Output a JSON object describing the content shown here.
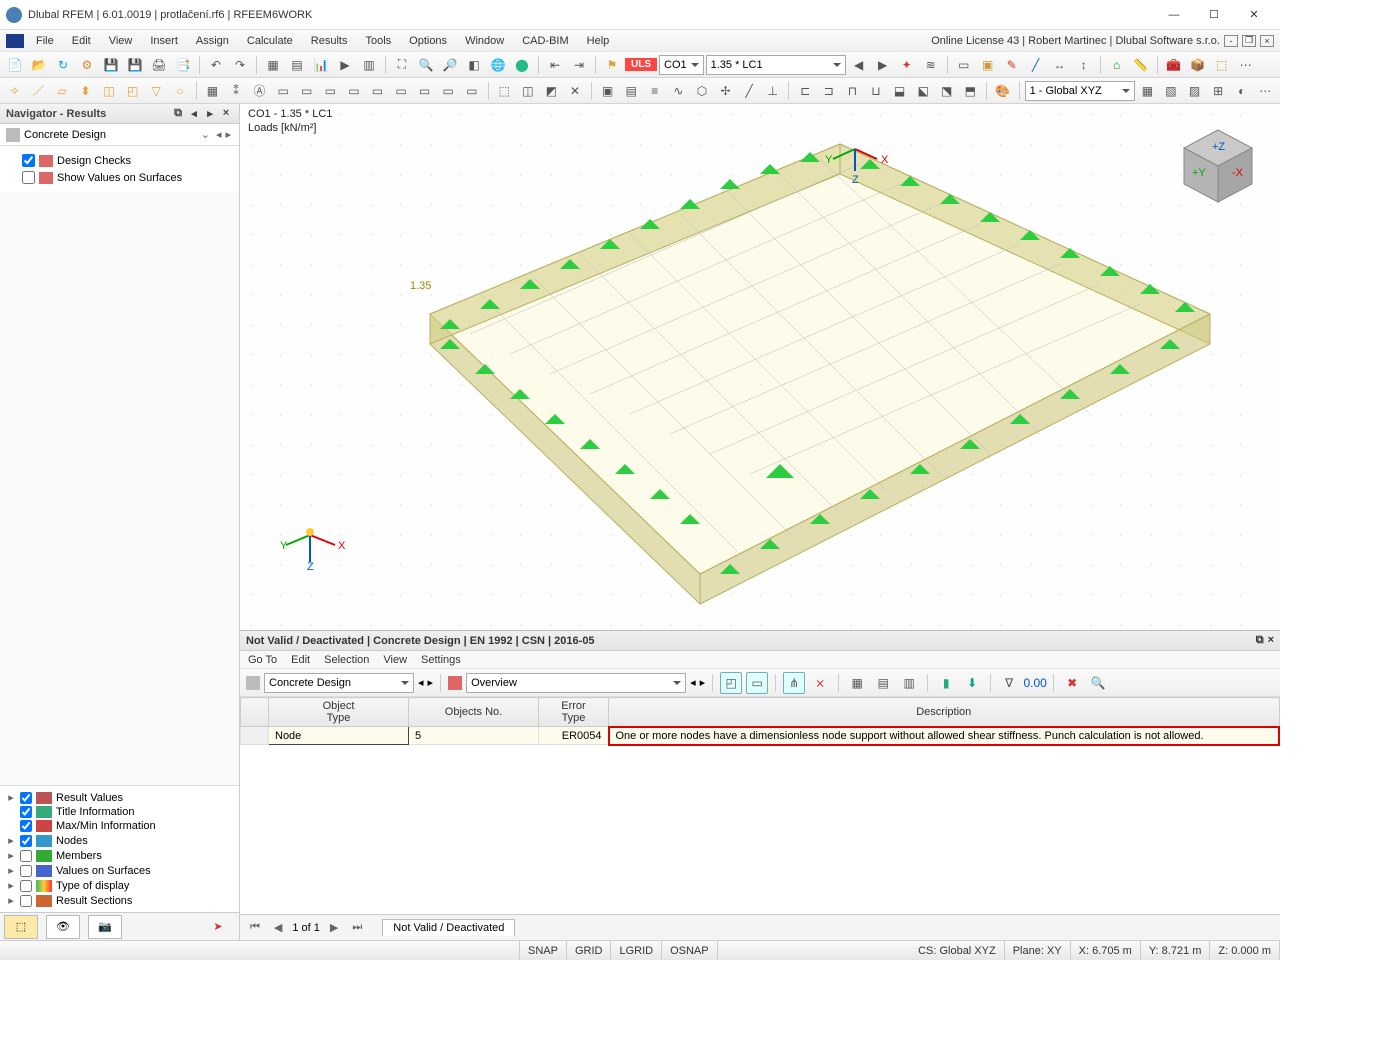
{
  "titlebar": {
    "title": "Dlubal RFEM | 6.01.0019 | protlačení.rf6 | RFEEM6WORK"
  },
  "subbar": {
    "menus": [
      "File",
      "Edit",
      "View",
      "Insert",
      "Assign",
      "Calculate",
      "Results",
      "Tools",
      "Options",
      "Window",
      "CAD-BIM",
      "Help"
    ],
    "license": "Online License 43 | Robert Martinec | Dlubal Software s.r.o."
  },
  "toolbar1": {
    "uls": "ULS",
    "co": "CO1",
    "coFactor": "1.35 * LC1",
    "coordsys": "1 - Global XYZ"
  },
  "nav": {
    "title": "Navigator - Results",
    "combo": "Concrete Design",
    "tree": [
      {
        "checked": true,
        "label": "Design Checks"
      },
      {
        "checked": false,
        "label": "Show Values on Surfaces"
      }
    ],
    "bottomTree": [
      {
        "checked": true,
        "label": "Result Values",
        "color": "#b55"
      },
      {
        "checked": true,
        "label": "Title Information",
        "color": "#3a7"
      },
      {
        "checked": true,
        "label": "Max/Min Information",
        "color": "#c44"
      },
      {
        "checked": true,
        "label": "Nodes",
        "color": "#39c"
      },
      {
        "checked": false,
        "label": "Members",
        "color": "#3a3"
      },
      {
        "checked": false,
        "label": "Values on Surfaces",
        "color": "#46c"
      },
      {
        "checked": false,
        "label": "Type of display",
        "color": "#3b6"
      },
      {
        "checked": false,
        "label": "Result Sections",
        "color": "#c63"
      }
    ]
  },
  "viewport": {
    "label1": "CO1 - 1.35 * LC1",
    "label2": "Loads [kN/m²]",
    "loadValue": "1.35"
  },
  "results": {
    "title": "Not Valid / Deactivated | Concrete Design | EN 1992 | CSN | 2016-05",
    "menus": [
      "Go To",
      "Edit",
      "Selection",
      "View",
      "Settings"
    ],
    "combo1": "Concrete Design",
    "combo2": "Overview",
    "headers": {
      "objtype": "Object\nType",
      "objno": "Objects No.",
      "errtype": "Error\nType",
      "desc": "Description"
    },
    "row": {
      "objtype": "Node",
      "objno": "5",
      "errtype": "ER0054",
      "desc": "One or more nodes have a dimensionless node support without allowed shear stiffness. Punch calculation is not allowed."
    },
    "pager": "1 of 1",
    "tab": "Not Valid / Deactivated"
  },
  "status": {
    "snap": "SNAP",
    "grid": "GRID",
    "lgrid": "LGRID",
    "osnap": "OSNAP",
    "cs": "CS: Global XYZ",
    "plane": "Plane: XY",
    "x": "X: 6.705 m",
    "y": "Y: 8.721 m",
    "z": "Z: 0.000 m"
  }
}
